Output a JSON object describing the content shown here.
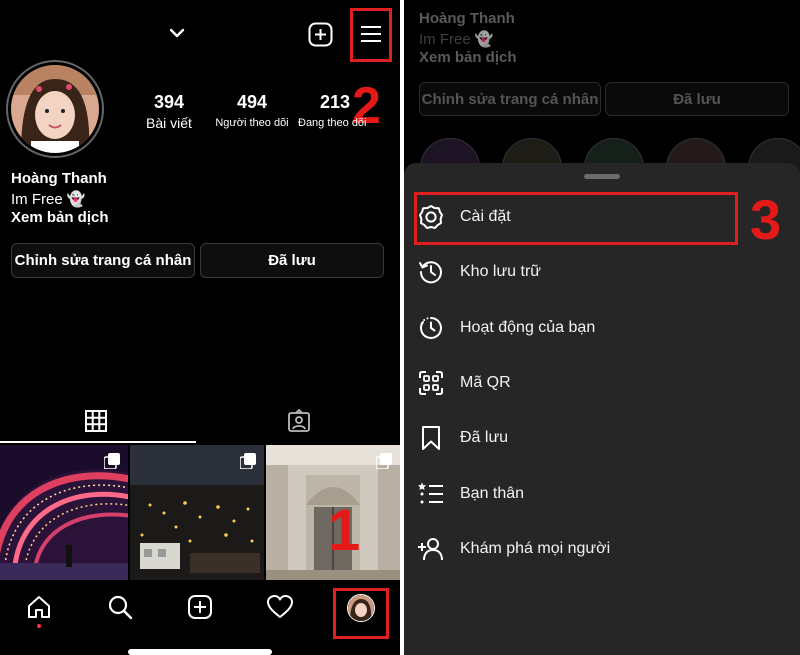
{
  "profile": {
    "username_chevron": "chevron-down-icon",
    "name": "Hoàng Thanh",
    "bio": "Im Free 👻",
    "translate": "Xem bản dịch",
    "stats": [
      {
        "value": "394",
        "label": "Bài viết"
      },
      {
        "value": "494",
        "label": "Người theo dõi"
      },
      {
        "value": "213",
        "label": "Đang theo dõi"
      }
    ],
    "edit_button": "Chỉnh sửa trang cá nhân",
    "saved_button": "Đã lưu"
  },
  "annotations": {
    "step1": "1",
    "step2": "2",
    "step3": "3"
  },
  "menu": {
    "items": [
      {
        "label": "Cài đặt",
        "icon": "settings-icon"
      },
      {
        "label": "Kho lưu trữ",
        "icon": "archive-icon"
      },
      {
        "label": "Hoạt động của bạn",
        "icon": "activity-icon"
      },
      {
        "label": "Mã QR",
        "icon": "qr-icon"
      },
      {
        "label": "Đã lưu",
        "icon": "bookmark-icon"
      },
      {
        "label": "Bạn thân",
        "icon": "close-friends-icon"
      },
      {
        "label": "Khám phá mọi người",
        "icon": "add-person-icon"
      }
    ]
  },
  "colors": {
    "background": "#000000",
    "sheet": "#262626",
    "highlight": "#e02020"
  }
}
